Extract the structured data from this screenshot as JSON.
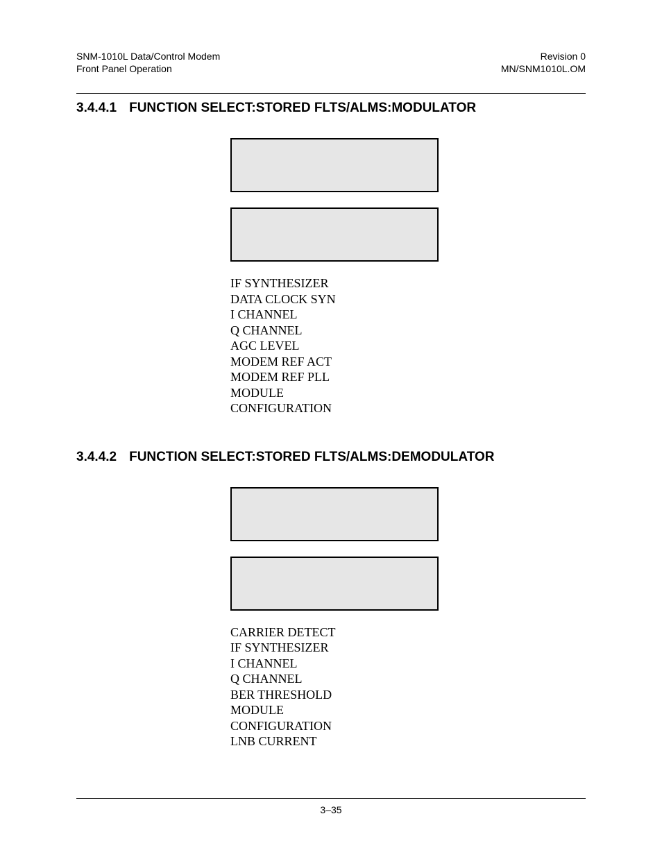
{
  "header": {
    "left_line1": "SNM-1010L Data/Control Modem",
    "left_line2": "Front Panel Operation",
    "right_line1": "Revision 0",
    "right_line2": "MN/SNM1010L.OM"
  },
  "section1": {
    "number": "3.4.4.1",
    "title": "FUNCTION SELECT:STORED FLTS/ALMS:MODULATOR",
    "items": [
      "IF SYNTHESIZER",
      "DATA CLOCK SYN",
      "I CHANNEL",
      "Q CHANNEL",
      "AGC LEVEL",
      "MODEM REF ACT",
      "MODEM REF PLL",
      "MODULE",
      "CONFIGURATION"
    ]
  },
  "section2": {
    "number": "3.4.4.2",
    "title": "FUNCTION SELECT:STORED FLTS/ALMS:DEMODULATOR",
    "items": [
      "CARRIER DETECT",
      "IF SYNTHESIZER",
      "I CHANNEL",
      "Q CHANNEL",
      "BER THRESHOLD",
      "MODULE",
      "CONFIGURATION",
      "LNB CURRENT"
    ]
  },
  "footer": {
    "page": "3–35"
  }
}
